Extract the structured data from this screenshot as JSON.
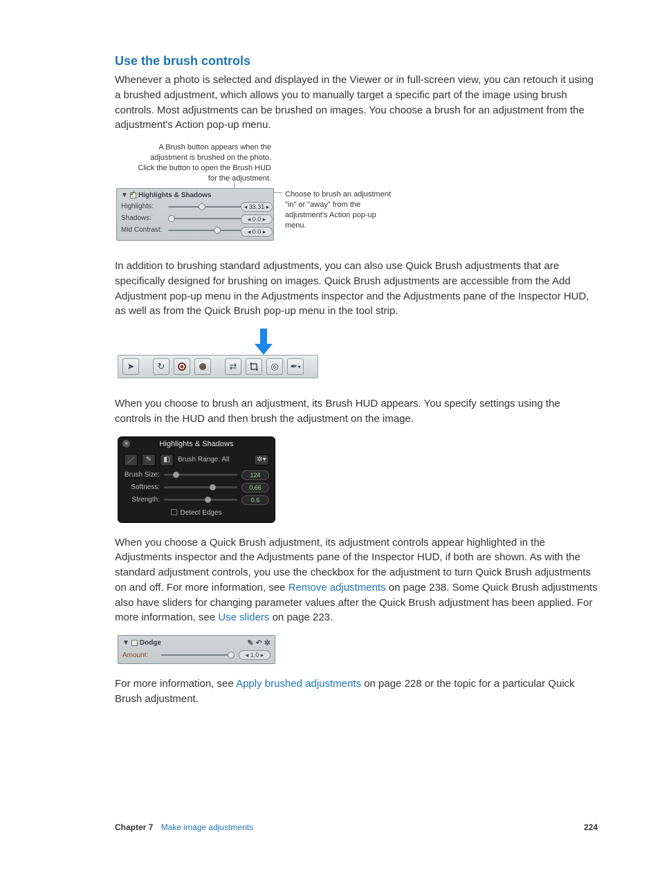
{
  "section": {
    "title": "Use the brush controls"
  },
  "paras": {
    "p1": "Whenever a photo is selected and displayed in the Viewer or in full-screen view, you can retouch it using a brushed adjustment, which allows you to manually target a specific part of the image using brush controls. Most adjustments can be brushed on images. You choose a brush for an adjustment from the adjustment's Action pop-up menu.",
    "p2": "In addition to brushing standard adjustments, you can also use Quick Brush adjustments that are specifically designed for brushing on images. Quick Brush adjustments are accessible from the Add Adjustment pop-up menu in the Adjustments inspector and the Adjustments pane of the Inspector HUD, as well as from the Quick Brush pop-up menu in the tool strip.",
    "p3": "When you choose to brush an adjustment, its Brush HUD appears. You specify settings using the controls in the HUD and then brush the adjustment on the image.",
    "p4a": "When you choose a Quick Brush adjustment, its adjustment controls appear highlighted in the Adjustments inspector and the Adjustments pane of the Inspector HUD, if both are shown. As with the standard adjustment controls, you use the checkbox for the adjustment to turn Quick Brush adjustments on and off. For more information, see ",
    "p4link1": "Remove adjustments",
    "p4b": " on page 238. Some Quick Brush adjustments also have sliders for changing parameter values after the Quick Brush adjustment has been applied. For more information, see ",
    "p4link2": "Use sliders",
    "p4c": " on page 223.",
    "p5a": "For more information, see ",
    "p5link": "Apply brushed adjustments",
    "p5b": " on page 228 or the topic for a particular Quick Brush adjustment."
  },
  "fig1": {
    "ann_left": "A Brush button appears when the adjustment is brushed on the photo. Click the button to open the Brush HUD for the adjustment.",
    "ann_right": "Choose to brush an adjustment \"in\" or \"away\" from the adjustment's Action pop-up menu.",
    "panel_title": "Highlights & Shadows",
    "rows": {
      "highlights": {
        "label": "Highlights:",
        "value": "33.31"
      },
      "shadows": {
        "label": "Shadows:",
        "value": "0.0"
      },
      "midcontrast": {
        "label": "Mid Contrast:",
        "value": "0.0"
      }
    }
  },
  "hud": {
    "title": "Highlights & Shadows",
    "range_label": "Brush Range: All",
    "rows": {
      "brushsize": {
        "label": "Brush Size:",
        "value": "124"
      },
      "softness": {
        "label": "Softness:",
        "value": "0.66"
      },
      "strength": {
        "label": "Strength:",
        "value": "0.6"
      }
    },
    "detect": "Detect Edges"
  },
  "dodge": {
    "title": "Dodge",
    "amount_label": "Amount:",
    "amount_value": "1.0"
  },
  "footer": {
    "chapter_label": "Chapter 7",
    "chapter_title": "Make image adjustments",
    "page": "224"
  }
}
